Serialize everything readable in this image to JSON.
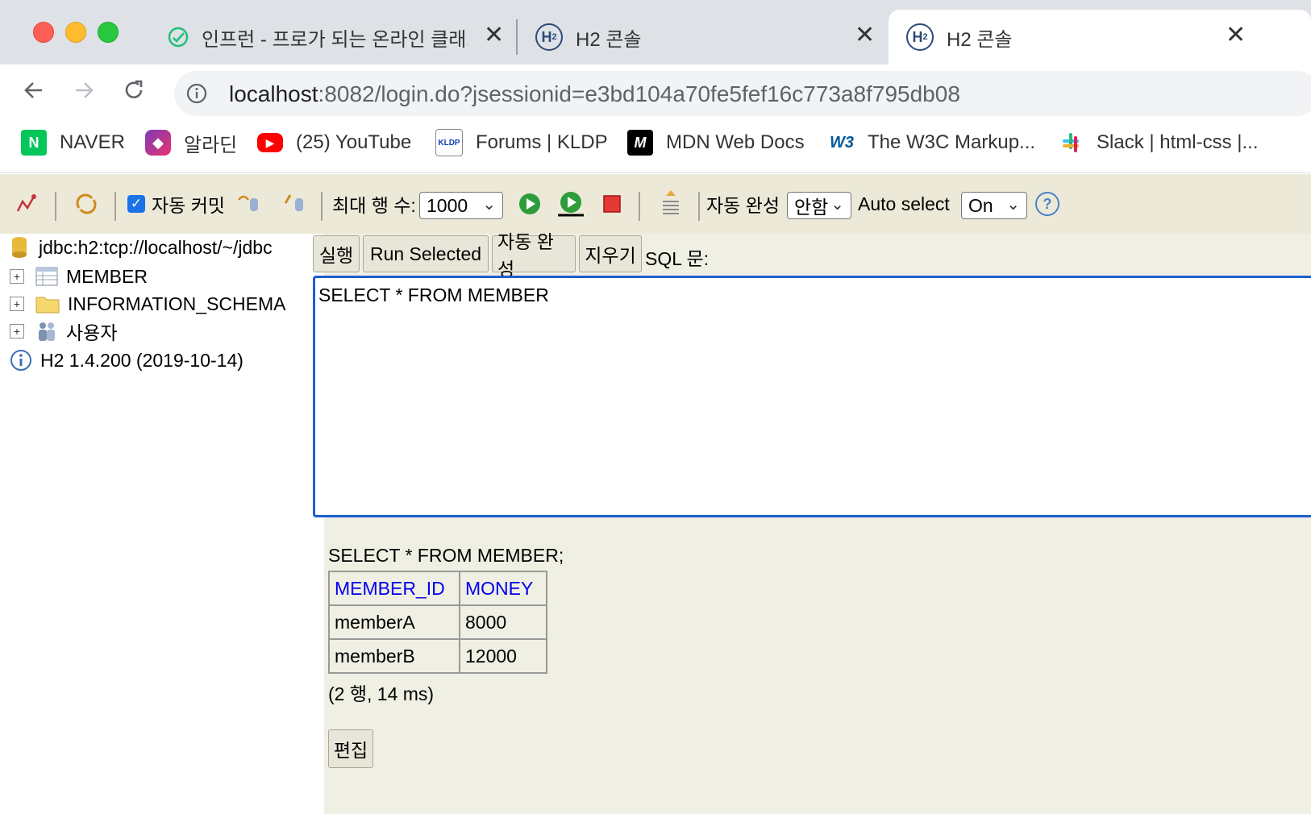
{
  "browser": {
    "tabs": [
      {
        "title": "인프런 - 프로가 되는 온라인 클래스 |",
        "icon": "inflearn-icon",
        "active": false
      },
      {
        "title": "H2 콘솔",
        "icon": "h2-icon",
        "active": false
      },
      {
        "title": "H2 콘솔",
        "icon": "h2-icon",
        "active": true
      }
    ],
    "tab_close_glyph": "✕",
    "url_host": "localhost",
    "url_rest": ":8082/login.do?jsessionid=e3bd104a70fe5fef16c773a8f795db08",
    "bookmarks": [
      {
        "label": "NAVER",
        "icon": "naver-icon",
        "icon_text": "N",
        "color": "#03c75a"
      },
      {
        "label": "알라딘",
        "icon": "aladin-icon",
        "icon_text": "",
        "color": "#d6246e"
      },
      {
        "label": "(25) YouTube",
        "icon": "youtube-icon",
        "icon_text": "▶",
        "color": "#ff0000"
      },
      {
        "label": "Forums | KLDP",
        "icon": "kldp-icon",
        "icon_text": "KLDP",
        "color": "#ffffff"
      },
      {
        "label": "MDN Web Docs",
        "icon": "mdn-icon",
        "icon_text": "M",
        "color": "#000000"
      },
      {
        "label": "The W3C Markup...",
        "icon": "w3c-icon",
        "icon_text": "W3",
        "color": "#ffffff"
      },
      {
        "label": "Slack | html-css |...",
        "icon": "slack-icon",
        "icon_text": "#",
        "color": "#ffffff"
      }
    ]
  },
  "toolbar": {
    "autocommit_label": "자동 커밋",
    "autocommit_checked": true,
    "max_rows_label": "최대 행 수:",
    "max_rows_value": "1000",
    "autocomplete_label": "자동 완성",
    "autocomplete_value": "안함",
    "auto_select_label": "Auto select",
    "auto_select_value": "On",
    "help_glyph": "?"
  },
  "tree": {
    "connection": "jdbc:h2:tcp://localhost/~/jdbc",
    "items": [
      {
        "label": "MEMBER",
        "icon": "table-icon"
      },
      {
        "label": "INFORMATION_SCHEMA",
        "icon": "folder-icon"
      },
      {
        "label": "사용자",
        "icon": "users-icon"
      }
    ],
    "version": "H2 1.4.200 (2019-10-14)"
  },
  "query_bar": {
    "run_label": "실행",
    "run_selected_label": "Run Selected",
    "autocomplete_label": "자동 완성",
    "clear_label": "지우기",
    "sql_label": "SQL 문:"
  },
  "editor": {
    "sql": "SELECT * FROM MEMBER"
  },
  "result": {
    "query": "SELECT * FROM MEMBER;",
    "columns": [
      "MEMBER_ID",
      "MONEY"
    ],
    "rows": [
      [
        "memberA",
        "8000"
      ],
      [
        "memberB",
        "12000"
      ]
    ],
    "meta": "(2 행, 14 ms)",
    "edit_label": "편집"
  }
}
